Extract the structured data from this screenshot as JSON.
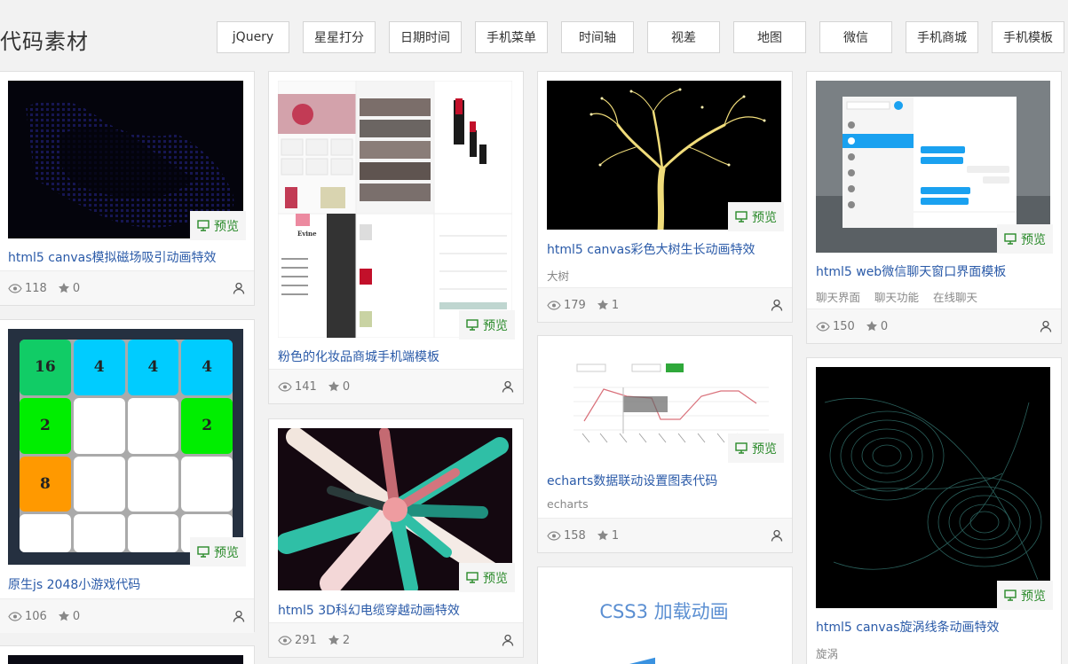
{
  "brand": "代码素材",
  "tags": [
    "jQuery",
    "星星打分",
    "日期时间",
    "手机菜单",
    "时间轴",
    "视差",
    "地图",
    "微信",
    "手机商城",
    "手机模板"
  ],
  "preview_label": "预览",
  "cards": [
    {
      "title": "html5 canvas模拟磁场吸引动画特效",
      "tags": [],
      "views": "118",
      "stars": "0"
    },
    {
      "title": "原生js 2048小游戏代码",
      "tags": [],
      "views": "106",
      "stars": "0"
    },
    {
      "title": "粉色的化妆品商城手机端模板",
      "tags": [],
      "views": "141",
      "stars": "0"
    },
    {
      "title": "html5 3D科幻电缆穿越动画特效",
      "tags": [],
      "views": "291",
      "stars": "2"
    },
    {
      "title": "html5 canvas彩色大树生长动画特效",
      "tags": [
        "大树"
      ],
      "views": "179",
      "stars": "1"
    },
    {
      "title": "echarts数据联动设置图表代码",
      "tags": [
        "echarts"
      ],
      "views": "158",
      "stars": "1"
    },
    {
      "title": "html5 web微信聊天窗口界面模板",
      "tags": [
        "聊天界面",
        "聊天功能",
        "在线聊天"
      ],
      "views": "150",
      "stars": "0"
    },
    {
      "title": "html5 canvas旋涡线条动画特效",
      "tags": [
        "旋涡"
      ],
      "views": "",
      "stars": ""
    }
  ],
  "game2048": [
    [
      "16",
      "4",
      "4",
      "4"
    ],
    [
      "2",
      "",
      "",
      "2"
    ],
    [
      "8",
      "",
      "",
      ""
    ],
    [
      "",
      "",
      "",
      ""
    ]
  ],
  "css3_title": "CSS3 加载动画",
  "cosmetics_brand": "Evine",
  "colors": {
    "title": "#2a5aa8",
    "preview": "#2a8a2a"
  }
}
